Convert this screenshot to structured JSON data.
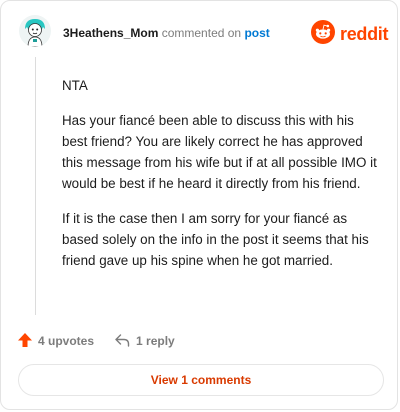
{
  "comment": {
    "author": "3Heathens_Mom",
    "action_text": "commented on",
    "post_link_label": "post",
    "paragraphs": [
      "NTA",
      "Has your fiancé been able to discuss this with his best friend? You are likely correct he has approved this message from his wife but if at all possible IMO it would be best if he heard it directly from his friend.",
      "If it is the case then I am sorry for your fiancé as based solely on the info in the post it seems that his friend gave up his spine when he got married."
    ]
  },
  "brand": {
    "wordmark": "reddit",
    "icon": "reddit-snoo-icon",
    "color": "#ff4500"
  },
  "footer": {
    "upvotes_label": "4 upvotes",
    "upvote_icon": "upvote-arrow-icon",
    "upvote_color": "#ff4500",
    "reply_label": "1 reply",
    "reply_icon": "reply-arrow-icon"
  },
  "view_comments": {
    "label": "View 1 comments",
    "color": "#d93a00"
  }
}
